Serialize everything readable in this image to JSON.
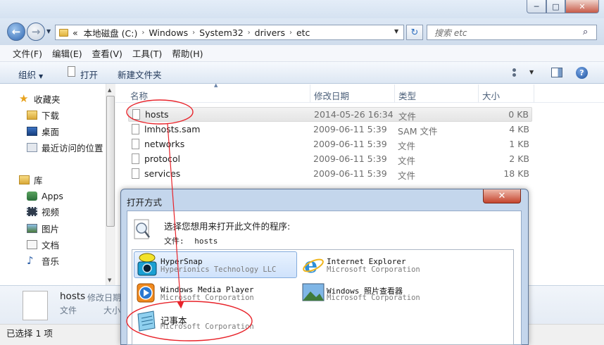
{
  "window": {
    "min_glyph": "─",
    "max_glyph": "□",
    "close_glyph": "✕"
  },
  "nav": {
    "back_glyph": "←",
    "forward_glyph": "→",
    "dropdown_glyph": "▼"
  },
  "address": {
    "prefix": "«",
    "crumbs": [
      "本地磁盘 (C:)",
      "Windows",
      "System32",
      "drivers",
      "etc"
    ],
    "separator": "›",
    "refresh_glyph": "↻"
  },
  "search": {
    "placeholder": "搜索 etc",
    "icon_glyph": "⌕"
  },
  "menu": [
    "文件(F)",
    "编辑(E)",
    "查看(V)",
    "工具(T)",
    "帮助(H)"
  ],
  "toolbar": {
    "organize": "组织",
    "open": "打开",
    "new_folder": "新建文件夹",
    "help_glyph": "?"
  },
  "sidebar": {
    "favorites_header": "收藏夹",
    "favorites": [
      "下载",
      "桌面",
      "最近访问的位置"
    ],
    "libraries_header": "库",
    "libraries": [
      "Apps",
      "视频",
      "图片",
      "文档",
      "音乐"
    ]
  },
  "columns": {
    "name": "名称",
    "date": "修改日期",
    "type": "类型",
    "size": "大小",
    "sort_glyph": "▲"
  },
  "files": [
    {
      "name": "hosts",
      "date": "2014-05-26 16:34",
      "type": "文件",
      "size": "0 KB",
      "selected": true
    },
    {
      "name": "lmhosts.sam",
      "date": "2009-06-11 5:39",
      "type": "SAM 文件",
      "size": "4 KB"
    },
    {
      "name": "networks",
      "date": "2009-06-11 5:39",
      "type": "文件",
      "size": "1 KB"
    },
    {
      "name": "protocol",
      "date": "2009-06-11 5:39",
      "type": "文件",
      "size": "2 KB"
    },
    {
      "name": "services",
      "date": "2009-06-11 5:39",
      "type": "文件",
      "size": "18 KB"
    }
  ],
  "details": {
    "name": "hosts",
    "type": "文件",
    "label_date": "修改日期",
    "label_size": "大小"
  },
  "status": {
    "text": "已选择 1 项"
  },
  "dialog": {
    "title": "打开方式",
    "close_glyph": "✕",
    "prompt": "选择您想用来打开此文件的程序:",
    "file_label": "文件:",
    "file_name": "hosts",
    "programs": [
      {
        "name": "HyperSnap",
        "publisher": "Hyperionics Technology LLC",
        "selected": true
      },
      {
        "name": "Internet Explorer",
        "publisher": "Microsoft Corporation"
      },
      {
        "name": "Windows Media Player",
        "publisher": "Microsoft Corporation"
      },
      {
        "name": "Windows 照片查看器",
        "publisher": "Microsoft Corporation"
      },
      {
        "name": "记事本",
        "publisher": "Microsoft Corporation"
      }
    ]
  },
  "colors": {
    "annotation_red": "#e8232a",
    "selection_blue": "#cfe2fb"
  }
}
